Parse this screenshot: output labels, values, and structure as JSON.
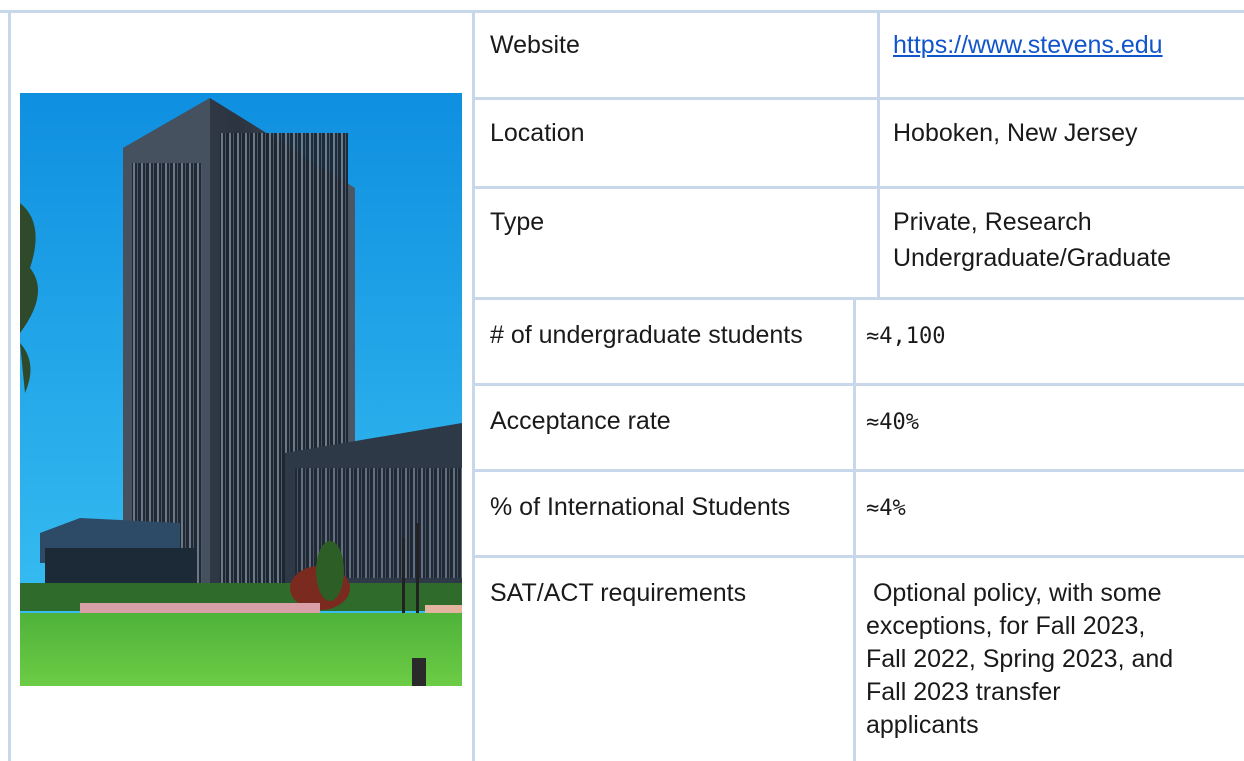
{
  "photo": {
    "description_icon": "building-photo"
  },
  "rows": [
    {
      "label": "Website",
      "value": "https://www.stevens.edu",
      "is_link": true
    },
    {
      "label": "Location",
      "value": "Hoboken, New Jersey"
    },
    {
      "label": "Type",
      "value_lines": [
        "Private, Research",
        "Undergraduate/Graduate"
      ]
    },
    {
      "label": "# of undergraduate students",
      "value": "≈4,100"
    },
    {
      "label": "Acceptance rate",
      "value": "≈40%"
    },
    {
      "label": "% of International Students",
      "value": "≈4%"
    },
    {
      "label": "SAT/ACT requirements",
      "value_lines": [
        " Optional policy, with some",
        "exceptions, for Fall 2023,",
        "Fall 2022, Spring 2023, and",
        "Fall 2023 transfer",
        "applicants"
      ]
    }
  ],
  "colors": {
    "grid": "#c9d7ea",
    "link": "#1155cc",
    "sky": "#17a4e8",
    "grass": "#5cc33f"
  }
}
